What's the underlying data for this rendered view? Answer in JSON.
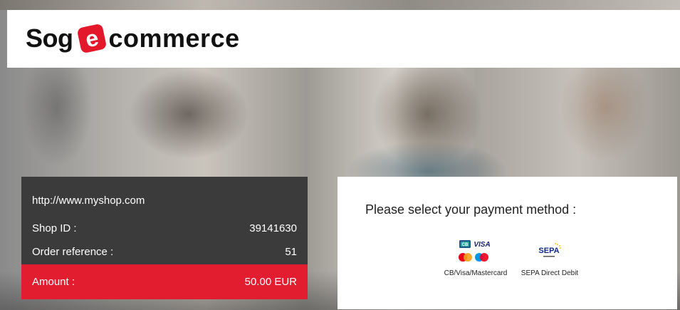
{
  "brand": {
    "prefix": "Sog",
    "letter": "e",
    "suffix": "commerce",
    "accent_color": "#e3192b"
  },
  "order": {
    "shop_url": "http://www.myshop.com",
    "shop_id_label": "Shop ID :",
    "shop_id_value": "39141630",
    "reference_label": "Order reference :",
    "reference_value": "51",
    "amount_label": "Amount :",
    "amount_value": "50.00 EUR"
  },
  "payment": {
    "title": "Please select your payment method :",
    "methods": [
      {
        "label": "CB/Visa/Mastercard",
        "icons": [
          "cb-icon",
          "visa-icon",
          "mastercard-icon",
          "maestro-icon"
        ]
      },
      {
        "label": "SEPA Direct Debit",
        "icons": [
          "sepa-icon"
        ]
      }
    ],
    "cb_text": "CB",
    "visa_text": "VISA",
    "sepa_text": "SEPA"
  },
  "colors": {
    "panel_dark": "#3b3b3b",
    "amount_red": "#e11d2f",
    "visa_blue": "#1a1f71",
    "mc_red": "#eb001b",
    "mc_orange": "#f79e1b",
    "maestro_blue": "#0099df",
    "sepa_blue": "#10298e",
    "sepa_yellow": "#ffcc00"
  }
}
